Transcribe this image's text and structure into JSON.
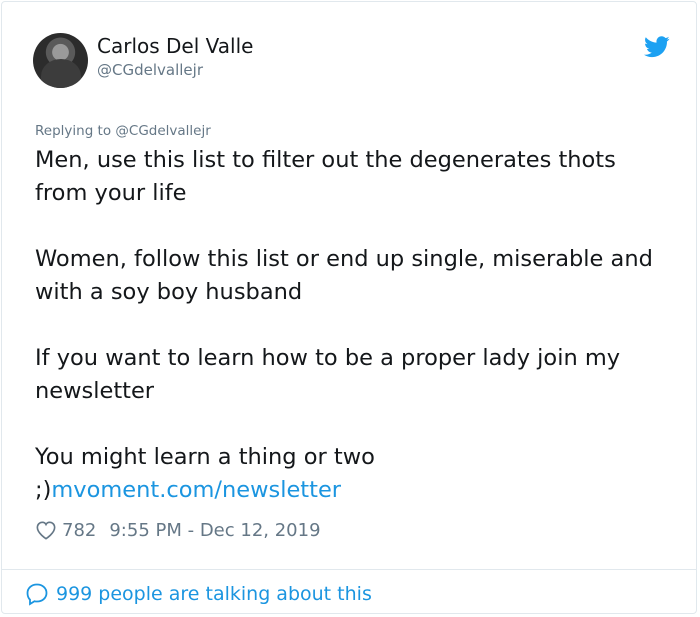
{
  "author": {
    "name": "Carlos Del Valle",
    "handle": "@CGdelvallejr"
  },
  "icons": {
    "brand": "twitter-bird-icon",
    "like": "heart-icon",
    "conversation": "speech-bubble-icon"
  },
  "colors": {
    "brand_blue": "#1da1f2",
    "link_blue": "#1b95e0",
    "secondary_text": "#657786",
    "primary_text": "#14171a"
  },
  "reply": {
    "prefix": "Replying to",
    "mention": "@CGdelvallejr"
  },
  "tweet": {
    "p1": "Men, use this list to filter out the degenerates thots from your life",
    "p2": "Women, follow this list or end up single, miserable and with a soy boy husband",
    "p3": "If you want to learn how to be a proper lady join my newsletter",
    "p4": "You might learn a thing or two",
    "p5_prefix": ";)",
    "link": "mvoment.com/newsletter"
  },
  "meta": {
    "likes": "782",
    "timestamp": "9:55 PM - Dec 12, 2019"
  },
  "footer": {
    "text": "999 people are talking about this"
  }
}
